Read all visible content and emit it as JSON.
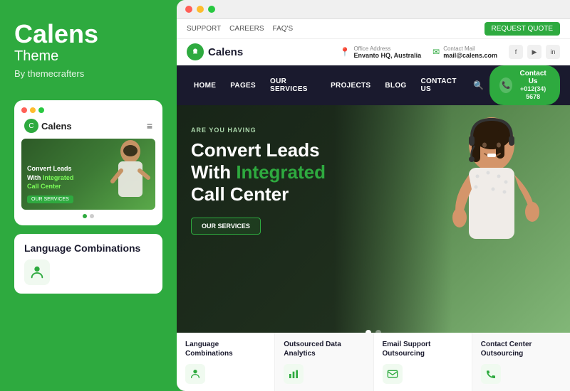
{
  "left": {
    "brand": {
      "title": "Calens",
      "subtitle": "Theme",
      "by": "By themecrafters"
    },
    "mobile": {
      "dots": [
        "red",
        "yellow",
        "green"
      ],
      "logo_text": "Calens",
      "hero_pretitle": "Convert Leads",
      "hero_title": "With Integrated",
      "hero_title_accent": "Call Center",
      "hero_btn": "OUR SERVICES",
      "dots_label": "slider"
    },
    "lang_card": {
      "title": "Language Combinations",
      "icon": "👤"
    }
  },
  "right": {
    "browser_dots": [
      "red",
      "yellow",
      "green"
    ],
    "topbar": {
      "links": [
        "SUPPORT",
        "CAREERS",
        "FAQ'S"
      ],
      "quote_btn": "REQUEST QUOTE"
    },
    "header": {
      "logo_text": "Calens",
      "office_label": "Office Address",
      "office_value": "Envanto HQ, Australia",
      "mail_label": "Contact Mail",
      "mail_value": "mail@calens.com",
      "socials": [
        "f",
        "▶",
        "in"
      ]
    },
    "navbar": {
      "items": [
        "HOME",
        "PAGES",
        "OUR SERVICES",
        "PROJECTS",
        "BLOG",
        "CONTACT US"
      ],
      "phone_text": "+012(34) 5678",
      "contact_btn": "Contact Us"
    },
    "hero": {
      "pretitle": "ARE YOU HAVING",
      "line1": "Convert Leads",
      "line2": "With",
      "line2_accent": "Integrated",
      "line3": "Call Center",
      "services_btn": "OUR SERVICES"
    },
    "bottom_cards": [
      {
        "title": "Language Combinations",
        "icon": "👤"
      },
      {
        "title": "Outsourced Data Analytics",
        "icon": "📊"
      },
      {
        "title": "Email Support Outsourcing",
        "icon": "✉"
      },
      {
        "title": "Contact Center Outsourcing",
        "icon": "📞"
      }
    ]
  }
}
